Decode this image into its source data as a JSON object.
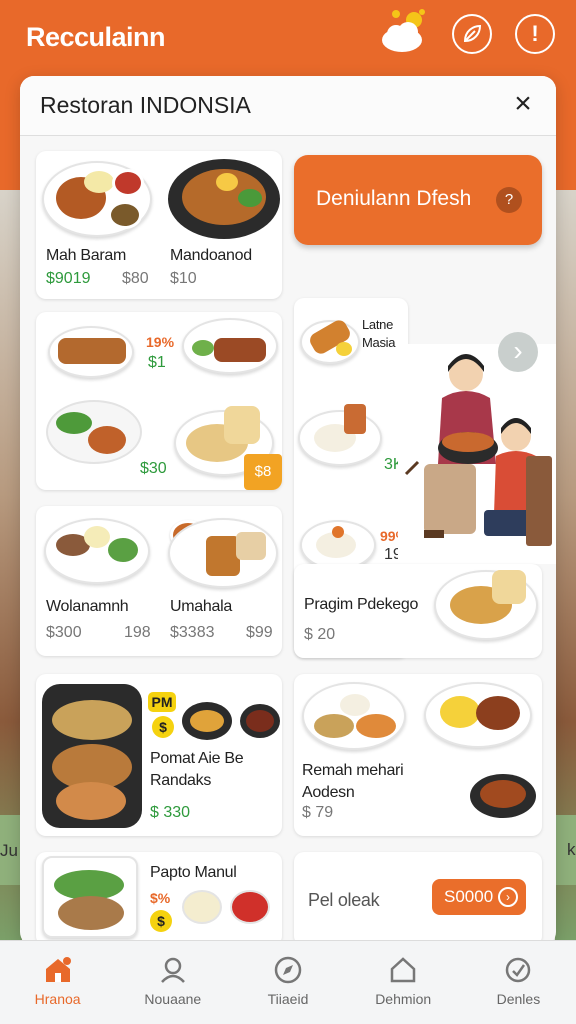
{
  "app": {
    "title": "Recculainn"
  },
  "modal": {
    "title": "Restoran INDONSIA",
    "close": "×",
    "cta": {
      "label": "Deniulann Dfesh",
      "help": "?"
    },
    "cards": {
      "c1": {
        "name1": "Mah Baram",
        "price1": "$9019",
        "price1b": "$80",
        "name2": "Mandoanod",
        "price2": "$10"
      },
      "c2": {
        "tag": "19%",
        "price_a": "$1",
        "price_b": "$30",
        "badge": "$8"
      },
      "c3": {
        "name": "Latne Masia",
        "price": "3K",
        "tag": "99%",
        "tag2": "19"
      },
      "c4": {
        "name1": "Wolanamnh",
        "price1": "$300",
        "price1b": "198",
        "name2": "Umahala",
        "price2": "$3383",
        "price2b": "$99"
      },
      "c5": {
        "name": "Pragim Pdekego",
        "price": "$ 20"
      },
      "c6": {
        "pill": "PM",
        "pill2": "$",
        "name": "Pomat Aie Be Randaks",
        "price": "$ 330"
      },
      "c7": {
        "name": "Remah mehari Aodesn",
        "price": "$ 79"
      },
      "c8": {
        "name": "Papto Manul",
        "tag": "$%",
        "pill2": "$"
      },
      "c9": {
        "label": "Pel oleak",
        "button": "S0000",
        "icon": "›"
      }
    }
  },
  "side": {
    "left": "Ju fie",
    "right": "k"
  },
  "nav": [
    {
      "label": "Hranoa",
      "icon": "home-icon",
      "active": true
    },
    {
      "label": "Nouaane",
      "icon": "user-icon",
      "active": false
    },
    {
      "label": "Tiiaeid",
      "icon": "compass-icon",
      "active": false
    },
    {
      "label": "Dehmion",
      "icon": "house-outline-icon",
      "active": false
    },
    {
      "label": "Denles",
      "icon": "settings-icon",
      "active": false
    }
  ],
  "colors": {
    "accent": "#e8692a",
    "price_green": "#2e9a3c",
    "badge": "#f2a323"
  }
}
